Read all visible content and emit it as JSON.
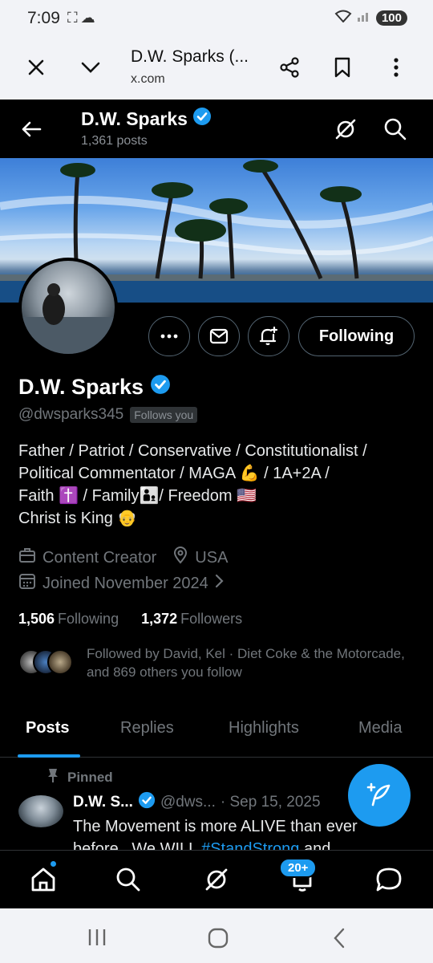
{
  "status": {
    "time": "7:09",
    "battery": "100"
  },
  "browser": {
    "title": "D.W. Sparks (...",
    "url": "x.com"
  },
  "header": {
    "name": "D.W. Sparks",
    "posts_count": "1,361 posts"
  },
  "actions": {
    "following_label": "Following"
  },
  "profile": {
    "name": "D.W. Sparks",
    "handle": "@dwsparks345",
    "follows_you": "Follows you",
    "bio_line1": "Father / Patriot / Conservative / Constitutionalist /",
    "bio_line2": "Political Commentator / MAGA 💪 / 1A+2A /",
    "bio_line3": "Faith ✝️ / Family👨‍👦/ Freedom 🇺🇸",
    "bio_line4": "Christ is King 👴",
    "category": "Content Creator",
    "location": "USA",
    "joined": "Joined November 2024",
    "following_count": "1,506",
    "following_label": "Following",
    "followers_count": "1,372",
    "followers_label": "Followers",
    "followed_by": "Followed by David, Kel · Diet Coke & the Motorcade, and 869 others you follow"
  },
  "tabs": [
    {
      "label": "Posts"
    },
    {
      "label": "Replies"
    },
    {
      "label": "Highlights"
    },
    {
      "label": "Media"
    }
  ],
  "tweet": {
    "pinned_label": "Pinned",
    "name": "D.W. S...",
    "handle": "@dws...",
    "date": "· Sep 15, 2025",
    "text_line1": "The Movement is more ALIVE than ever",
    "text_pre": "before...We WILL ",
    "hashtag": "#StandStrong",
    "text_post": " and"
  },
  "bottom_nav": {
    "notifications_badge": "20+"
  },
  "colors": {
    "accent": "#1d9bf0",
    "background": "#000000",
    "muted": "#71767b"
  }
}
